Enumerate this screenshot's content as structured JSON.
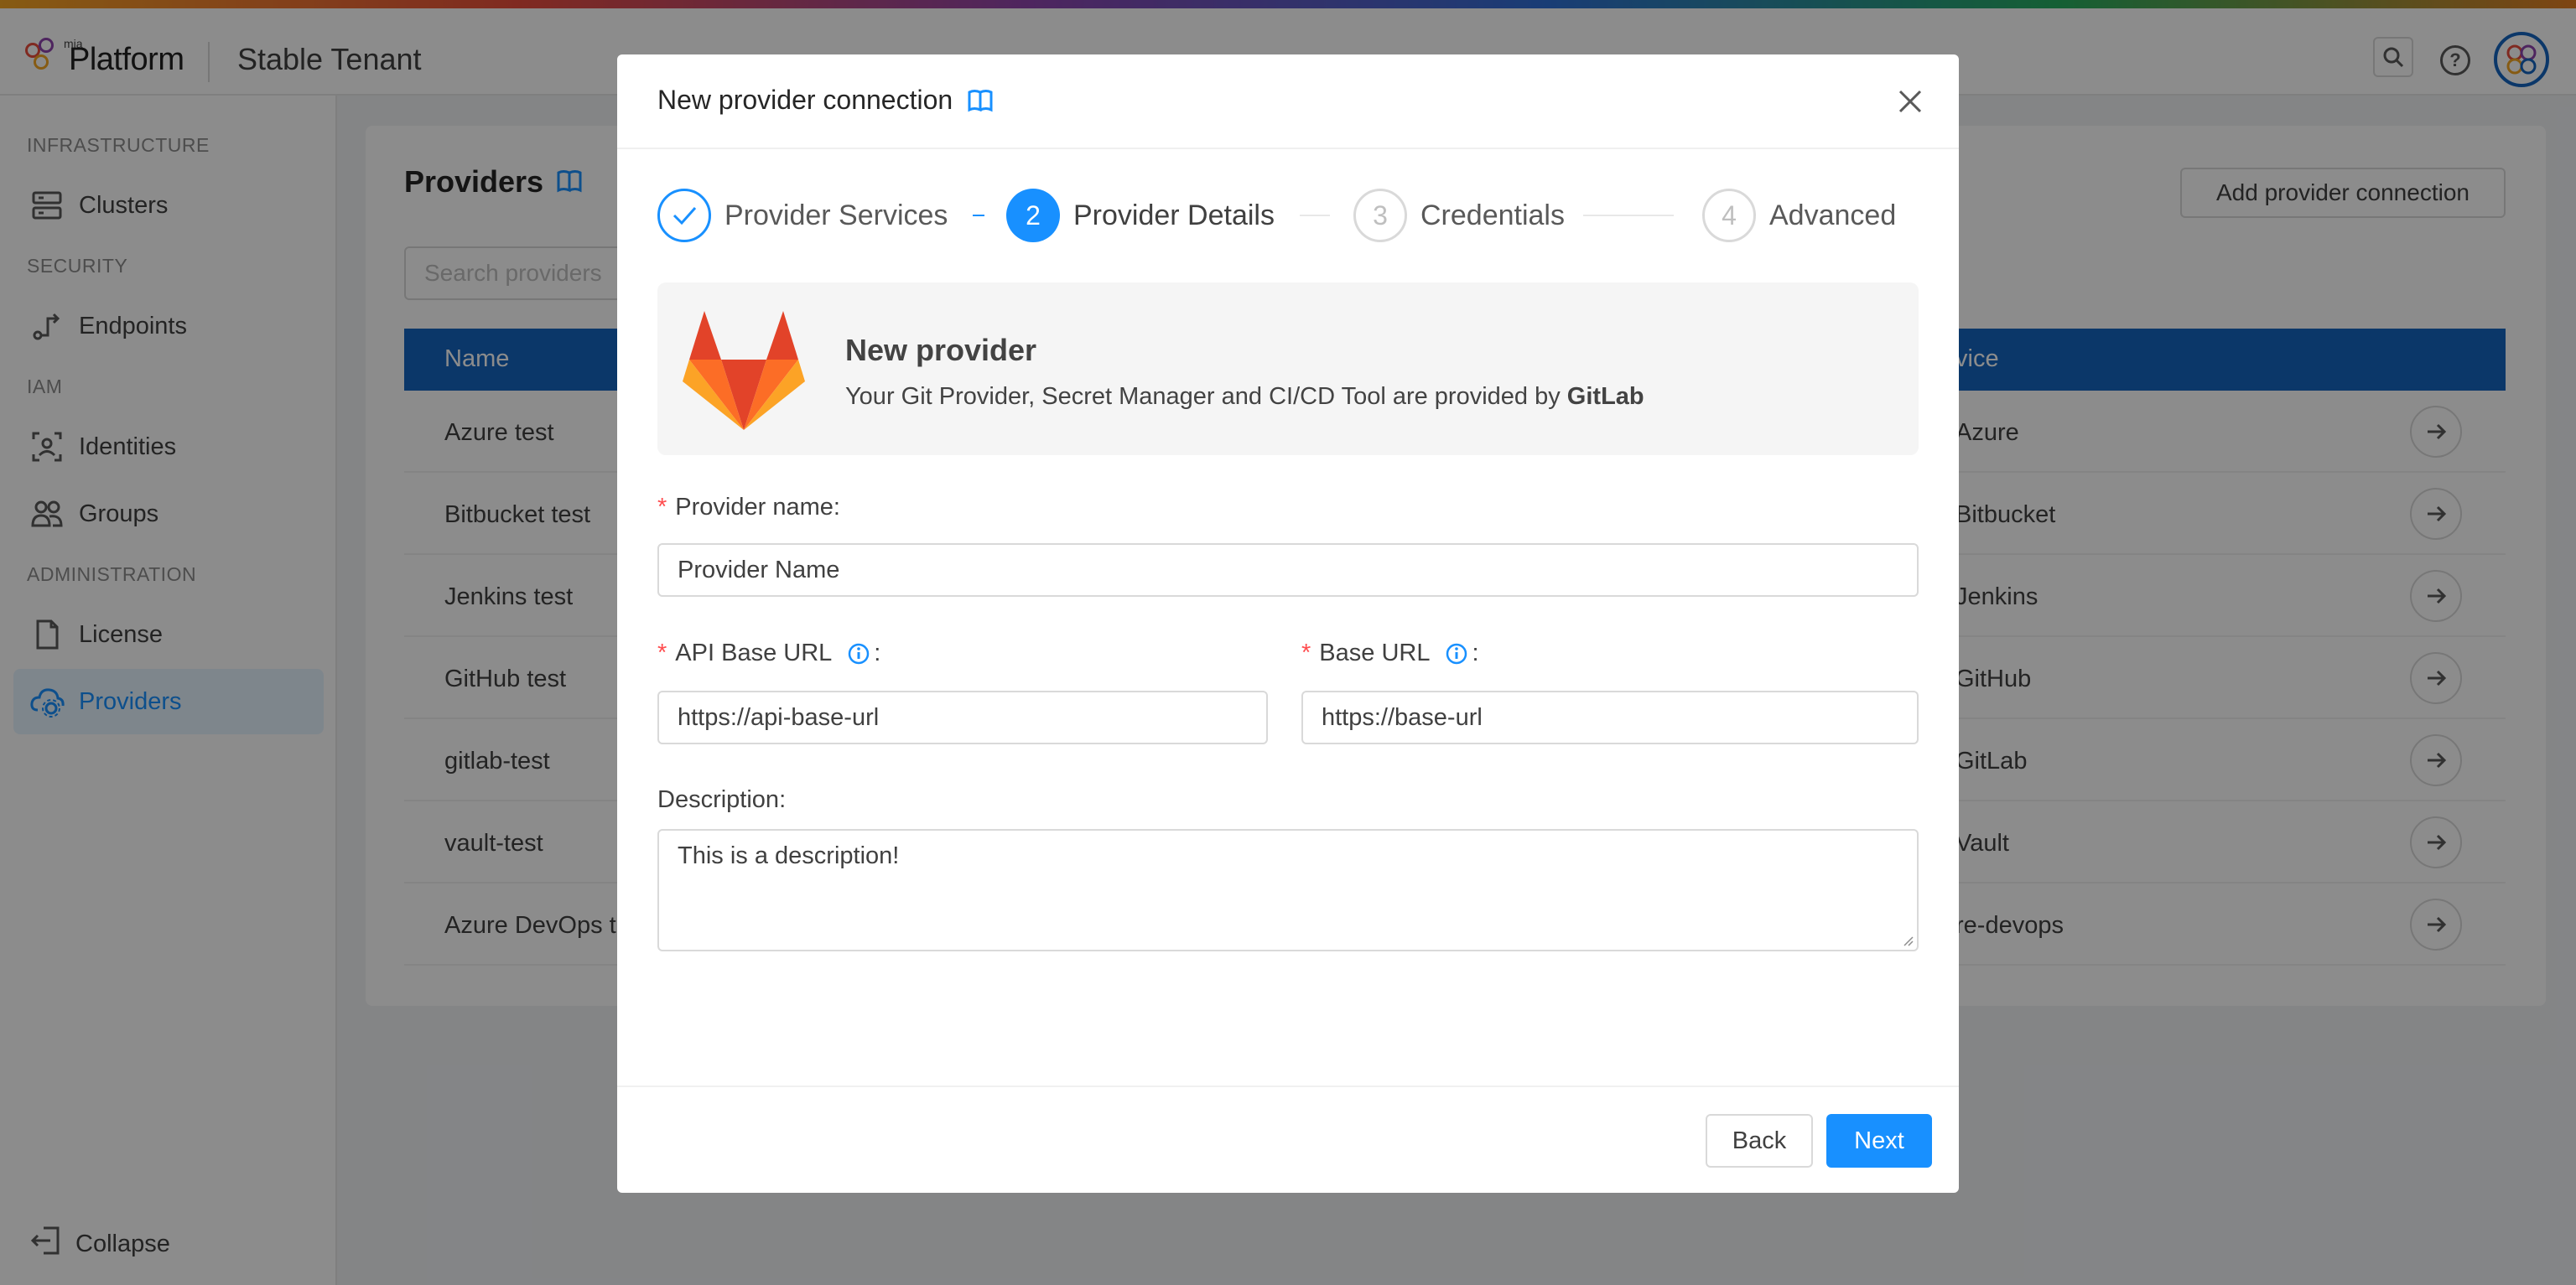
{
  "app": {
    "brand_small": "mia",
    "brand": "Platform",
    "tenant": "Stable Tenant"
  },
  "sidebar": {
    "sections": [
      {
        "title": "INFRASTRUCTURE",
        "items": [
          {
            "label": "Clusters",
            "icon": "server-icon"
          }
        ]
      },
      {
        "title": "SECURITY",
        "items": [
          {
            "label": "Endpoints",
            "icon": "endpoint-icon"
          }
        ]
      },
      {
        "title": "IAM",
        "items": [
          {
            "label": "Identities",
            "icon": "identity-icon"
          },
          {
            "label": "Groups",
            "icon": "group-icon"
          }
        ]
      },
      {
        "title": "ADMINISTRATION",
        "items": [
          {
            "label": "License",
            "icon": "document-icon"
          },
          {
            "label": "Providers",
            "icon": "cloud-gear-icon",
            "active": true
          }
        ]
      }
    ],
    "collapse_label": "Collapse"
  },
  "page": {
    "title": "Providers",
    "add_button": "Add provider connection",
    "search_placeholder": "Search providers",
    "table": {
      "headers": [
        "Name",
        "vice"
      ],
      "rows": [
        {
          "name": "Azure test",
          "service": "Azure"
        },
        {
          "name": "Bitbucket test",
          "service": "Bitbucket"
        },
        {
          "name": "Jenkins test",
          "service": "Jenkins"
        },
        {
          "name": "GitHub test",
          "service": "GitHub"
        },
        {
          "name": "gitlab-test",
          "service": "GitLab"
        },
        {
          "name": "vault-test",
          "service": "Vault"
        },
        {
          "name": "Azure DevOps t",
          "service": "re-devops"
        }
      ]
    }
  },
  "modal": {
    "title": "New provider connection",
    "steps": [
      {
        "number": "1",
        "label": "Provider Services",
        "status": "done"
      },
      {
        "number": "2",
        "label": "Provider Details",
        "status": "current"
      },
      {
        "number": "3",
        "label": "Credentials",
        "status": "wait"
      },
      {
        "number": "4",
        "label": "Advanced",
        "status": "wait"
      }
    ],
    "banner": {
      "title": "New provider",
      "description_prefix": "Your Git Provider, Secret Manager and CI/CD Tool are provided by ",
      "provider": "GitLab"
    },
    "fields": {
      "provider_name": {
        "label": "Provider name",
        "placeholder": "Provider Name",
        "value": ""
      },
      "api_base_url": {
        "label": "API Base URL",
        "value": "https://api-base-url"
      },
      "base_url": {
        "label": "Base URL",
        "value": "https://base-url"
      },
      "description": {
        "label": "Description",
        "value": "This is a description!"
      }
    },
    "buttons": {
      "back": "Back",
      "next": "Next"
    }
  },
  "colors": {
    "primary": "#1890ff",
    "table_header": "#1565c0",
    "required": "#ff4d4f",
    "gitlab_orange": "#fc6d26",
    "gitlab_red": "#e24329",
    "gitlab_light": "#fca326"
  }
}
